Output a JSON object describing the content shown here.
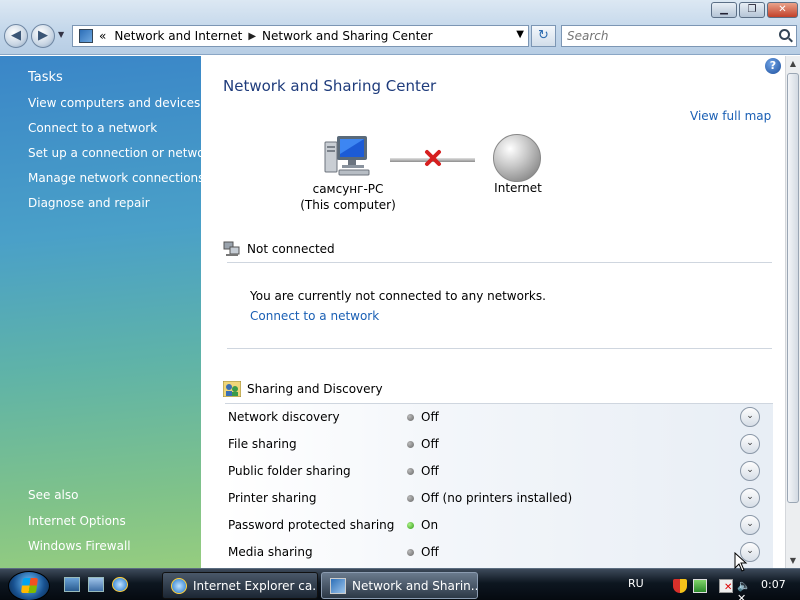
{
  "window": {
    "min": "▁",
    "max": "❐",
    "close": "✕"
  },
  "nav": {
    "back": "◀",
    "forward": "▶",
    "history": "▼"
  },
  "address": {
    "overflow": "«",
    "arrow": "▶",
    "breadcrumbs": [
      "Network and Internet",
      "Network and Sharing Center"
    ],
    "dropdown": "▼"
  },
  "refresh": "↻",
  "search": {
    "placeholder": "Search"
  },
  "taskpane": {
    "tasks_heading": "Tasks",
    "tasks": [
      "View computers and devices",
      "Connect to a network",
      "Set up a connection or network",
      "Manage network connections",
      "Diagnose and repair"
    ],
    "see_also_heading": "See also",
    "see_also": [
      "Internet Options",
      "Windows Firewall"
    ]
  },
  "main": {
    "help": "?",
    "title": "Network and Sharing Center",
    "view_full_map": "View full map",
    "computer_name": "самсунг-PC",
    "computer_caption": "(This computer)",
    "internet_label": "Internet",
    "connection_status": "Not connected",
    "not_connected_message": "You are currently not connected to any networks.",
    "connect_link": "Connect to a network",
    "sharing_heading": "Sharing and Discovery",
    "sharing_rows": [
      {
        "name": "Network discovery",
        "value": "Off",
        "on": false
      },
      {
        "name": "File sharing",
        "value": "Off",
        "on": false
      },
      {
        "name": "Public folder sharing",
        "value": "Off",
        "on": false
      },
      {
        "name": "Printer sharing",
        "value": "Off (no printers installed)",
        "on": false
      },
      {
        "name": "Password protected sharing",
        "value": "On",
        "on": true
      },
      {
        "name": "Media sharing",
        "value": "Off",
        "on": false
      }
    ],
    "expand_glyph": "⌄"
  },
  "scrollbar": {
    "up": "▲",
    "down": "▼"
  },
  "taskbar": {
    "tasks": [
      "Internet Explorer ca...",
      "Network and Sharin..."
    ],
    "language": "RU",
    "volume": "🔈✕",
    "clock": "0:07"
  },
  "colors": {
    "link": "#1a5fb4",
    "title": "#1f3c7c",
    "status_on": "#2d9b12",
    "status_off": "#7a7a7a"
  }
}
